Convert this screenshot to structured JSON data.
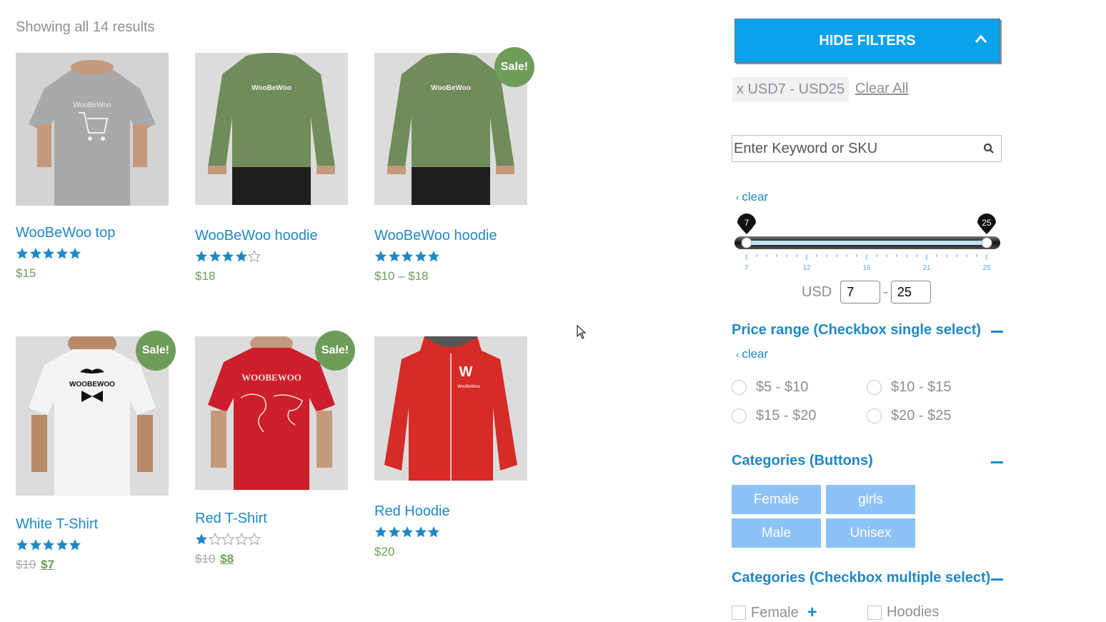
{
  "results_count": "Showing all 14 results",
  "products": [
    {
      "title": "WooBeWoo top",
      "rating": 5,
      "price": "$15",
      "sale": false,
      "sale_label": "",
      "image": "grey-tshirt"
    },
    {
      "title": "WooBeWoo hoodie",
      "rating": 4,
      "price": "$18",
      "sale": false,
      "sale_label": "",
      "image": "green-hoodie"
    },
    {
      "title": "WooBeWoo hoodie",
      "rating": 5,
      "price": "$10 – $18",
      "sale": true,
      "sale_label": "Sale!",
      "image": "green-hoodie"
    },
    {
      "title": "White T-Shirt",
      "rating": 5,
      "price_old": "$10",
      "price_new": "$7",
      "sale": true,
      "sale_label": "Sale!",
      "image": "white-tshirt"
    },
    {
      "title": "Red T-Shirt",
      "rating": 1,
      "price_old": "$10",
      "price_new": "$8",
      "sale": true,
      "sale_label": "Sale!",
      "image": "red-tshirt"
    },
    {
      "title": "Red Hoodie",
      "rating": 5,
      "price": "$20",
      "sale": false,
      "sale_label": "",
      "image": "red-hoodie"
    }
  ],
  "filters": {
    "hide_label": "HIDE FILTERS",
    "active_chip": "x USD7 - USD25",
    "clear_all": "Clear All",
    "search_placeholder": "Enter Keyword or SKU",
    "clear": "clear",
    "slider": {
      "min": 7,
      "max": 25,
      "low": 7,
      "high": 25,
      "low_label": "7",
      "high_label": "25",
      "tick_labels": [
        "7",
        "12",
        "16",
        "21",
        "25"
      ]
    },
    "currency": "USD",
    "from_value": "7",
    "to_value": "25",
    "dash": "-",
    "price_range_title": "Price range (Checkbox single select)",
    "price_ranges": [
      "$5 - $10",
      "$10 - $15",
      "$15 - $20",
      "$20 - $25"
    ],
    "categories_buttons_title": "Categories (Buttons)",
    "category_buttons": [
      "Female",
      "girls",
      "Male",
      "Unisex"
    ],
    "categories_checkbox_title": "Categories (Checkbox multiple select)",
    "category_checkboxes": [
      "Female",
      "Hoodies"
    ]
  },
  "colors": {
    "accent": "#1e88c7",
    "button_blue": "#0aa2ea",
    "sale_green": "#6e9d5a",
    "category_button": "#8cc2f5"
  }
}
